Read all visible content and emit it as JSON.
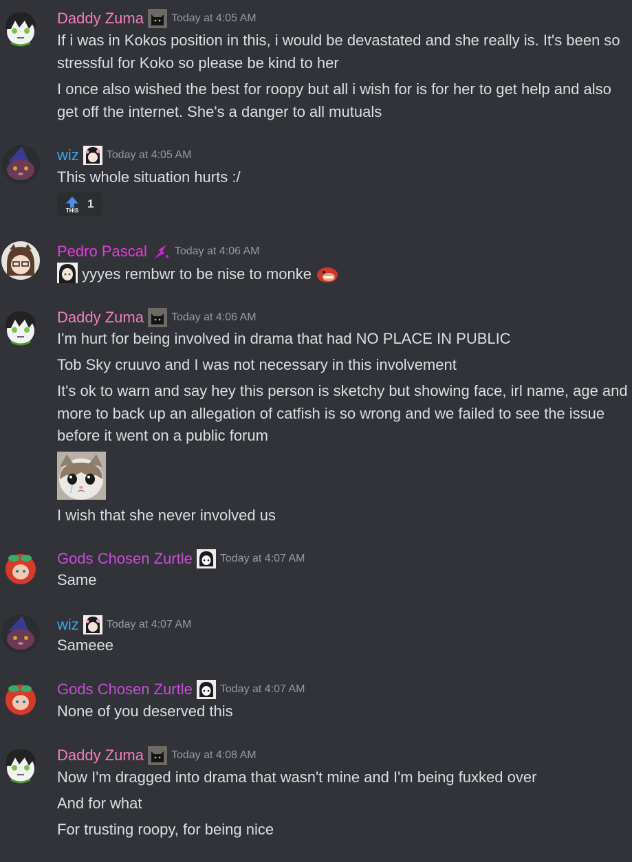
{
  "colors": {
    "background": "#313338",
    "text": "#dbdee1",
    "timestamp": "#949ba4",
    "daddy_zuma": "#f47fbd",
    "wiz": "#3aa4e8",
    "pedro_pascal": "#e53cd9",
    "zurtle": "#c64dd4"
  },
  "groups": [
    {
      "author": "Daddy Zuma",
      "badge_icon": "black-cat-icon",
      "time": "Today at 4:05 AM",
      "lines": [
        "If i was in Kokos position in this, i would be devastated and she really is. It's been so stressful for Koko so please be kind to her",
        "I once also wished the best for roopy but all i wish for is for her to get help and also get off the internet. She's a danger to all mutuals"
      ]
    },
    {
      "author": "wiz",
      "badge_icon": "anime-girl-flower-icon",
      "time": "Today at 4:05 AM",
      "lines": [
        "This whole situation hurts :/"
      ],
      "reaction": {
        "icon": "this-upvote-arrow-icon",
        "label": "THIS",
        "count": "1"
      }
    },
    {
      "author": "Pedro Pascal",
      "badge_icon": "purple-sparkle-icon",
      "time": "Today at 4:06 AM",
      "lines": [
        "yyyes rembwr to be nise to monke"
      ],
      "leading_emoji": "anime-girl-emoji",
      "trailing_emoji": "red-monkey-emoji"
    },
    {
      "author": "Daddy Zuma",
      "badge_icon": "black-cat-icon",
      "time": "Today at 4:06 AM",
      "lines": [
        "I'm hurt for being involved in drama that had NO PLACE IN PUBLIC",
        "Tob Sky cruuvo and I was not necessary in this involvement",
        "It's ok to warn and say hey this person is sketchy but showing face, irl name, age and more to back up an allegation of catfish is so wrong and we failed to see the issue before it went on a public forum",
        "I wish that she never involved us"
      ],
      "image": "crying-cat-image"
    },
    {
      "author": "Gods Chosen Zurtle",
      "badge_icon": "panda-girl-icon",
      "time": "Today at 4:07 AM",
      "lines": [
        "Same"
      ]
    },
    {
      "author": "wiz",
      "badge_icon": "anime-girl-flower-icon",
      "time": "Today at 4:07 AM",
      "lines": [
        "Sameee"
      ]
    },
    {
      "author": "Gods Chosen Zurtle",
      "badge_icon": "panda-girl-icon",
      "time": "Today at 4:07 AM",
      "lines": [
        "None of you deserved this"
      ]
    },
    {
      "author": "Daddy Zuma",
      "badge_icon": "black-cat-icon",
      "time": "Today at 4:08 AM",
      "lines": [
        "Now I'm dragged into drama that wasn't mine and I'm being fuxked over",
        "And for what",
        "For trusting roopy, for being nice"
      ]
    }
  ]
}
